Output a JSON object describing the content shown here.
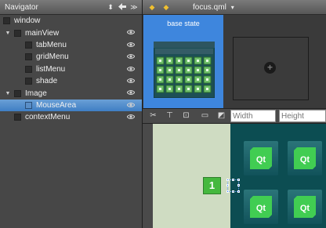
{
  "navigator": {
    "title": "Navigator",
    "items": [
      {
        "label": "window",
        "level": 0,
        "expandable": false,
        "selected": false,
        "visible_toggle": false
      },
      {
        "label": "mainView",
        "level": 1,
        "expandable": true,
        "selected": false,
        "visible_toggle": true
      },
      {
        "label": "tabMenu",
        "level": 2,
        "expandable": false,
        "selected": false,
        "visible_toggle": true
      },
      {
        "label": "gridMenu",
        "level": 2,
        "expandable": false,
        "selected": false,
        "visible_toggle": true
      },
      {
        "label": "listMenu",
        "level": 2,
        "expandable": false,
        "selected": false,
        "visible_toggle": true
      },
      {
        "label": "shade",
        "level": 2,
        "expandable": false,
        "selected": false,
        "visible_toggle": true
      },
      {
        "label": "Image",
        "level": 1,
        "expandable": true,
        "selected": false,
        "visible_toggle": true
      },
      {
        "label": "MouseArea",
        "level": 2,
        "expandable": false,
        "selected": true,
        "visible_toggle": true
      },
      {
        "label": "contextMenu",
        "level": 1,
        "expandable": false,
        "selected": false,
        "visible_toggle": true
      }
    ]
  },
  "editor": {
    "file_name": "focus.qml",
    "state_title": "base state"
  },
  "toolbar": {
    "width_placeholder": "Width",
    "height_placeholder": "Height"
  },
  "canvas": {
    "badge_number": "1",
    "tile_label": "Qt"
  },
  "colors": {
    "selection": "#3f7fc4",
    "state_card": "#3e86dd",
    "canvas_green": "#cfdcc2",
    "canvas_dark": "#0c4d52",
    "badge": "#45b83e",
    "qt_logo": "#41cd52"
  },
  "icons": [
    "dropdown-icon",
    "back-arrow-icon",
    "forward-icon",
    "eye-icon",
    "add-icon",
    "qt-logo-icon"
  ]
}
